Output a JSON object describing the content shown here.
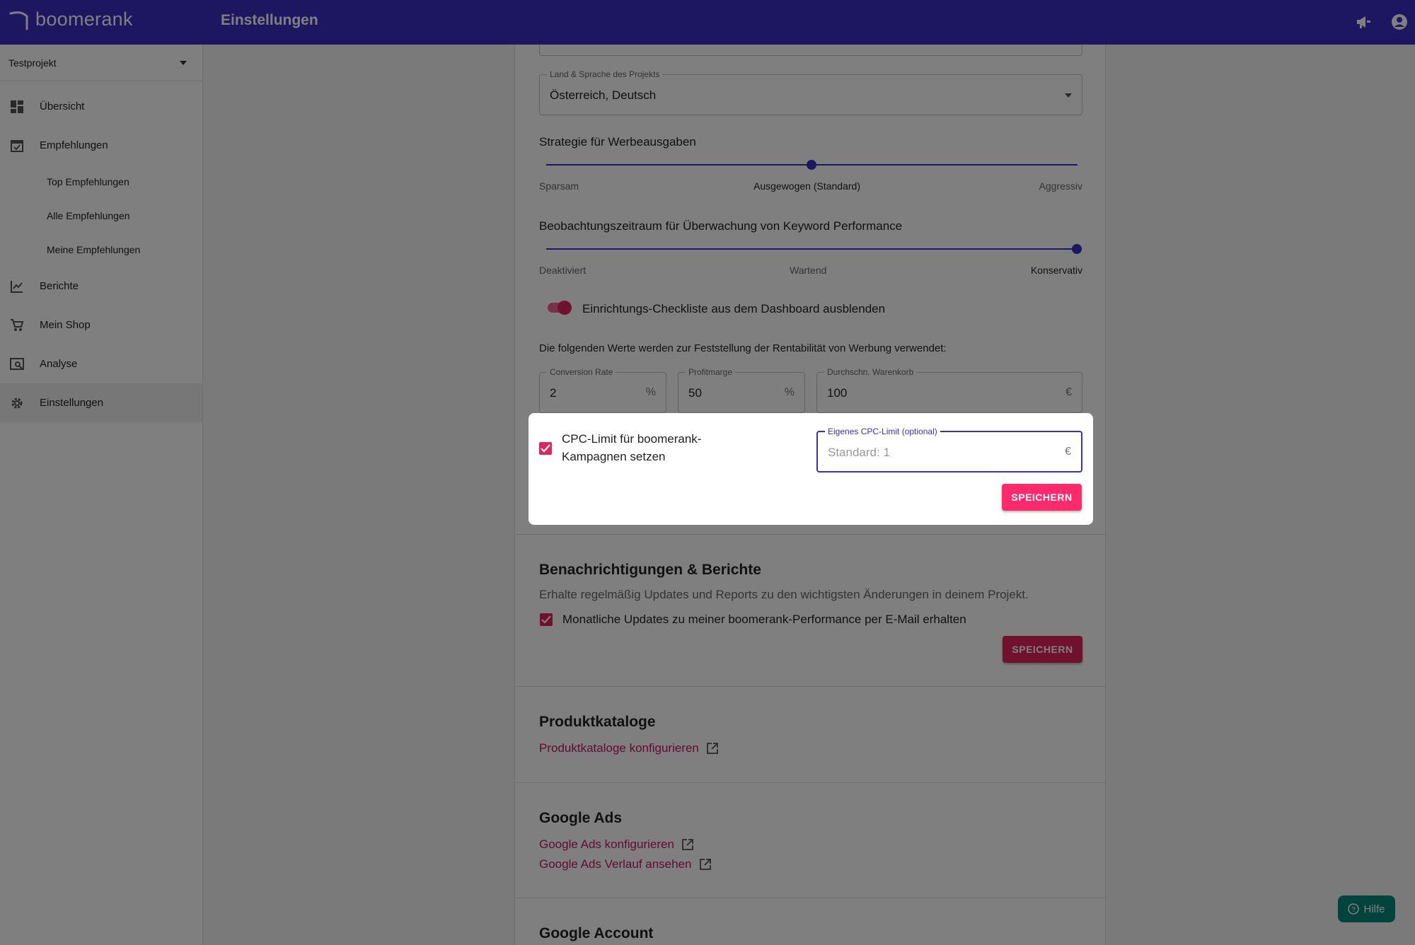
{
  "app": {
    "name": "boomerank",
    "page_title": "Einstellungen"
  },
  "colors": {
    "brand": "#3a2fc4",
    "accent": "#e0245e",
    "link": "#c2185b",
    "help": "#00897b"
  },
  "sidebar": {
    "project": "Testprojekt",
    "items": [
      {
        "label": "Übersicht",
        "icon": "dashboard-icon"
      },
      {
        "label": "Empfehlungen",
        "icon": "calendar-check-icon"
      },
      {
        "label": "Top Empfehlungen"
      },
      {
        "label": "Alle Empfehlungen"
      },
      {
        "label": "Meine Empfehlungen"
      },
      {
        "label": "Berichte",
        "icon": "chart-line-icon"
      },
      {
        "label": "Mein Shop",
        "icon": "cart-icon"
      },
      {
        "label": "Analyse",
        "icon": "analytics-icon"
      },
      {
        "label": "Einstellungen",
        "icon": "gear-icon",
        "active": true
      }
    ]
  },
  "settings": {
    "country_language": {
      "label": "Land & Sprache des Projekts",
      "value": "Österreich, Deutsch"
    },
    "spend_strategy": {
      "label": "Strategie für Werbeausgaben",
      "options": [
        "Sparsam",
        "Ausgewogen (Standard)",
        "Aggressiv"
      ],
      "selected": "Ausgewogen (Standard)"
    },
    "observation": {
      "label": "Beobachtungszeitraum für Überwachung von Keyword Performance",
      "options": [
        "Deaktiviert",
        "Wartend",
        "Konservativ"
      ],
      "selected": "Konservativ"
    },
    "checklist_toggle": {
      "label": "Einrichtungs-Checkliste aus dem Dashboard ausblenden",
      "on": true
    },
    "profitability_note": "Die folgenden Werte werden zur Feststellung der Rentabilität von Werbung verwendet:",
    "conversion_rate": {
      "label": "Conversion Rate",
      "value": "2",
      "unit": "%"
    },
    "profit_margin": {
      "label": "Profitmarge",
      "value": "50",
      "unit": "%"
    },
    "avg_cart": {
      "label": "Durchschn. Warenkorb",
      "value": "100",
      "unit": "€"
    },
    "cpc_limit": {
      "checkbox_label_1": "CPC-Limit für boomerank-",
      "checkbox_label_2": "Kampagnen setzen",
      "checked": true,
      "field_label": "Eigenes CPC-Limit (optional)",
      "placeholder": "Standard: 1",
      "unit": "€"
    },
    "save_label": "SPEICHERN"
  },
  "notifications": {
    "title": "Benachrichtigungen & Berichte",
    "description": "Erhalte regelmäßig Updates und Reports zu den wichtigsten Änderungen in deinem Projekt.",
    "checkbox_label": "Monatliche Updates zu meiner boomerank-Performance per E-Mail erhalten",
    "checked": true,
    "save_label": "SPEICHERN"
  },
  "catalogs": {
    "title": "Produktkataloge",
    "link": "Produktkataloge konfigurieren"
  },
  "google_ads": {
    "title": "Google Ads",
    "link_configure": "Google Ads konfigurieren",
    "link_history": "Google Ads Verlauf ansehen"
  },
  "google_account": {
    "title": "Google Account"
  },
  "help": {
    "label": "Hilfe"
  }
}
